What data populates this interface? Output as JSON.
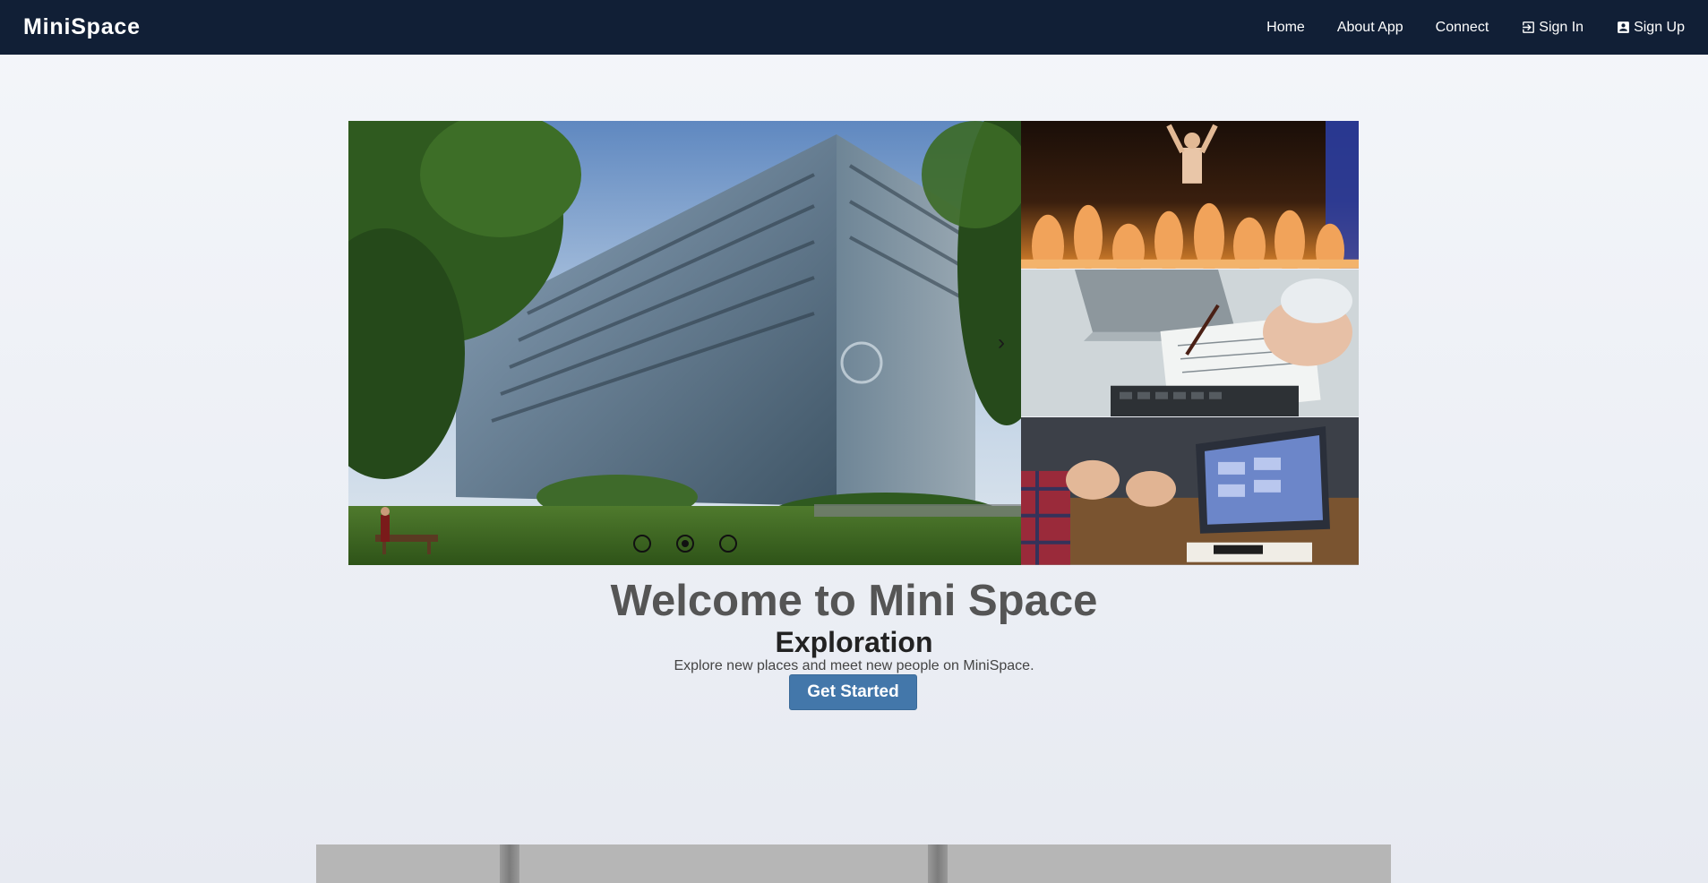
{
  "nav": {
    "brand": "MiniSpace",
    "links": [
      {
        "label": "Home"
      },
      {
        "label": "About App"
      },
      {
        "label": "Connect"
      },
      {
        "label": "Sign In",
        "icon": "sign-in-icon"
      },
      {
        "label": "Sign Up",
        "icon": "user-badge-icon"
      }
    ]
  },
  "hero": {
    "carousel": {
      "slide_count": 3,
      "active_index": 1,
      "next_icon": "chevron-right-icon"
    }
  },
  "welcome": {
    "title": "Welcome to Mini Space",
    "subtitle": "Exploration",
    "description": "Explore new places and meet new people on MiniSpace.",
    "cta_label": "Get Started"
  },
  "colors": {
    "navbar": "#111f36",
    "cta": "#4377aa",
    "title": "#555555"
  }
}
